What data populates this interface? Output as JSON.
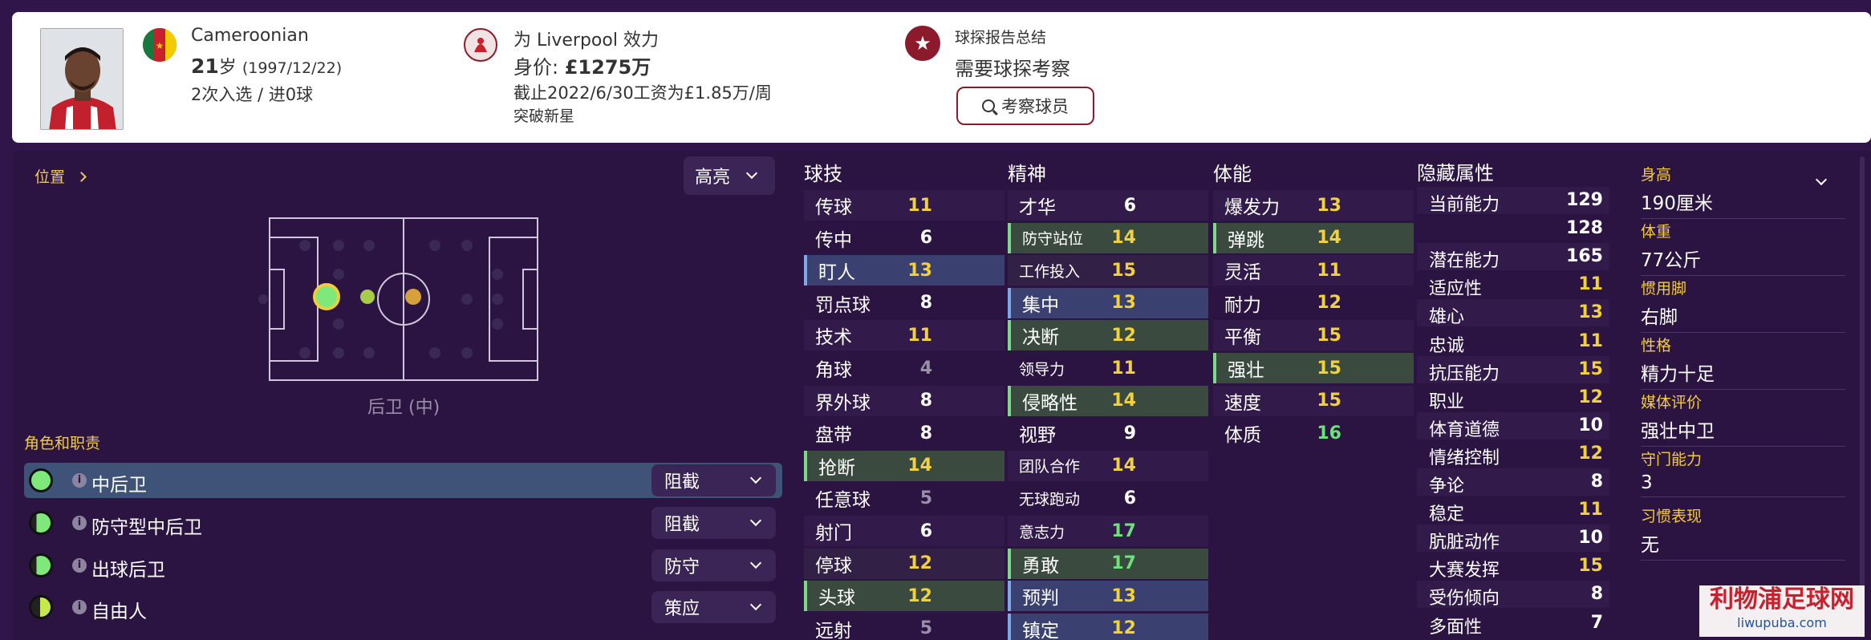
{
  "header": {
    "nationality": "Cameroonian",
    "age_num": "21",
    "age_unit": "岁",
    "birth": "(1997/12/22)",
    "apps": "2次入选 / 进0球",
    "club_line": "为 Liverpool 效力",
    "value_prefix": "身价: ",
    "value_amount": "£1275万",
    "contract": "截止2022/6/30工资为£1.85万/周",
    "tag": "突破新星",
    "scout_title": "球探报告总结",
    "scout_status": "需要球探考察",
    "scout_button": "考察球员"
  },
  "position": {
    "label": "位置",
    "highlight_select": "高亮",
    "position_name": "后卫 (中)"
  },
  "roles": {
    "title": "角色和职责",
    "items": [
      {
        "name": "中后卫",
        "duty": "阻截",
        "selected": true
      },
      {
        "name": "防守型中后卫",
        "duty": "阻截",
        "selected": false
      },
      {
        "name": "出球后卫",
        "duty": "防守",
        "selected": false
      },
      {
        "name": "自由人",
        "duty": "策应",
        "selected": false
      }
    ]
  },
  "technical": {
    "title": "球技",
    "attrs": [
      {
        "name": "传球",
        "value": "11"
      },
      {
        "name": "传中",
        "value": "6"
      },
      {
        "name": "盯人",
        "value": "13"
      },
      {
        "name": "罚点球",
        "value": "8"
      },
      {
        "name": "技术",
        "value": "11"
      },
      {
        "name": "角球",
        "value": "4"
      },
      {
        "name": "界外球",
        "value": "8"
      },
      {
        "name": "盘带",
        "value": "8"
      },
      {
        "name": "抢断",
        "value": "14"
      },
      {
        "name": "任意球",
        "value": "5"
      },
      {
        "name": "射门",
        "value": "6"
      },
      {
        "name": "停球",
        "value": "12"
      },
      {
        "name": "头球",
        "value": "12"
      },
      {
        "name": "远射",
        "value": "5"
      }
    ]
  },
  "mental": {
    "title": "精神",
    "attrs": [
      {
        "name": "才华",
        "value": "6"
      },
      {
        "name": "防守站位",
        "value": "14"
      },
      {
        "name": "工作投入",
        "value": "15"
      },
      {
        "name": "集中",
        "value": "13"
      },
      {
        "name": "决断",
        "value": "12"
      },
      {
        "name": "领导力",
        "value": "11"
      },
      {
        "name": "侵略性",
        "value": "14"
      },
      {
        "name": "视野",
        "value": "9"
      },
      {
        "name": "团队合作",
        "value": "14"
      },
      {
        "name": "无球跑动",
        "value": "6"
      },
      {
        "name": "意志力",
        "value": "17"
      },
      {
        "name": "勇敢",
        "value": "17"
      },
      {
        "name": "预判",
        "value": "13"
      },
      {
        "name": "镇定",
        "value": "12"
      }
    ]
  },
  "physical": {
    "title": "体能",
    "attrs": [
      {
        "name": "爆发力",
        "value": "13"
      },
      {
        "name": "弹跳",
        "value": "14"
      },
      {
        "name": "灵活",
        "value": "11"
      },
      {
        "name": "耐力",
        "value": "12"
      },
      {
        "name": "平衡",
        "value": "15"
      },
      {
        "name": "强壮",
        "value": "15"
      },
      {
        "name": "速度",
        "value": "15"
      },
      {
        "name": "体质",
        "value": "16"
      }
    ]
  },
  "hidden": {
    "title": "隐藏属性",
    "attrs": [
      {
        "name": "当前能力",
        "value": "129"
      },
      {
        "name": "",
        "value": "128"
      },
      {
        "name": "潜在能力",
        "value": "165"
      },
      {
        "name": "适应性",
        "value": "11"
      },
      {
        "name": "雄心",
        "value": "13"
      },
      {
        "name": "忠诚",
        "value": "11"
      },
      {
        "name": "抗压能力",
        "value": "15"
      },
      {
        "name": "职业",
        "value": "12"
      },
      {
        "name": "体育道德",
        "value": "10"
      },
      {
        "name": "情绪控制",
        "value": "12"
      },
      {
        "name": "争论",
        "value": "8"
      },
      {
        "name": "稳定",
        "value": "11"
      },
      {
        "name": "肮脏动作",
        "value": "10"
      },
      {
        "name": "大赛发挥",
        "value": "15"
      },
      {
        "name": "受伤倾向",
        "value": "8"
      },
      {
        "name": "多面性",
        "value": "7"
      }
    ]
  },
  "info": {
    "height_label": "身高",
    "height": "190厘米",
    "weight_label": "体重",
    "weight": "77公斤",
    "foot_label": "惯用脚",
    "foot": "右脚",
    "personality_label": "性格",
    "personality": "精力十足",
    "media_label": "媒体评价",
    "media": "强壮中卫",
    "gk_label": "守门能力",
    "gk": "3",
    "habits_label": "习惯表现",
    "habits": "无"
  },
  "watermark": {
    "title": "利物浦足球网",
    "url": "liwupuba.com"
  },
  "colors": {
    "white_val": "#ffffff",
    "yellow_val": "#f2d23c",
    "green_val": "#6de27a",
    "grey_val": "#9a90a8",
    "ballwinning_highlight": "#3a3e6a",
    "physical_highlight": "#3a4a3a",
    "header_accent": "#8b1b2c"
  }
}
